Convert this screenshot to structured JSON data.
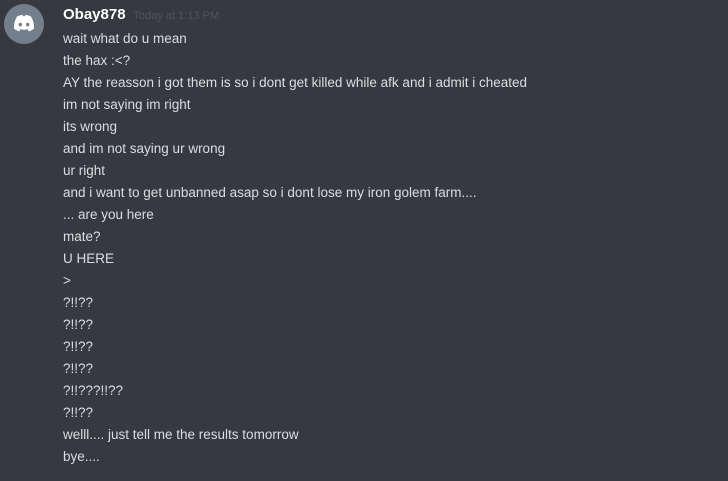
{
  "message_group": {
    "username": "Obay878",
    "timestamp": "Today at 1:13 PM",
    "avatar_icon": "discord-logo-icon",
    "avatar_color": "#747f8d",
    "messages": [
      "wait what do u mean",
      "the hax :<?",
      "AY the reasson i got them is so i dont get killed while afk and i admit i cheated",
      "im not saying im right",
      "its wrong",
      "and im not saying ur wrong",
      "ur right",
      "and i want to get unbanned asap so  i dont lose my iron golem farm....",
      "... are you here",
      "mate?",
      "U HERE",
      ">",
      "?!!??",
      "?!!??",
      "?!!??",
      "?!!??",
      "?!!???!!??",
      "?!!??",
      "welll.... just tell me the results tomorrow",
      "bye...."
    ]
  },
  "colors": {
    "background": "#36393f",
    "username": "#ffffff",
    "timestamp": "#4f545c",
    "message_text": "#dcddde"
  }
}
